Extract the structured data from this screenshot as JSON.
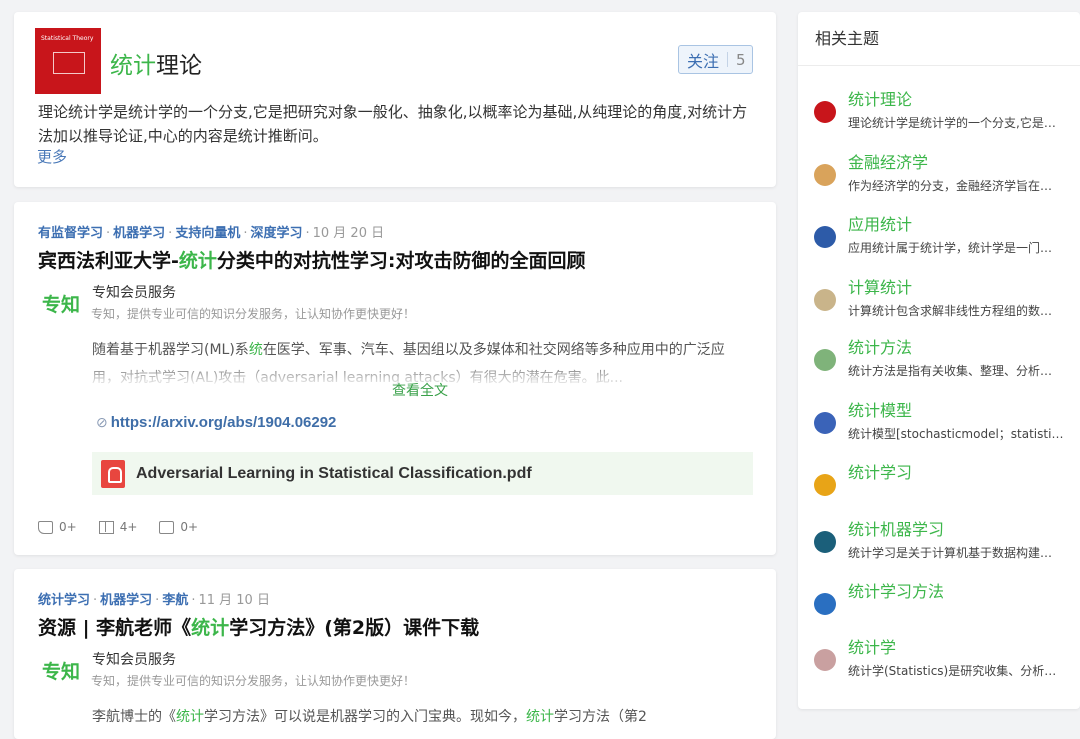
{
  "topic": {
    "cover_text": "Statistical Theory",
    "title_hl": "统计",
    "title_rest": "理论",
    "follow_label": "关注",
    "follow_count": "5",
    "description": "理论统计学是统计学的一个分支,它是把研究对象一般化、抽象化,以概率论为基础,从纯理论的角度,对统计方法加以推导论证,中心的内容是统计推断问。",
    "more": "更多"
  },
  "articles": [
    {
      "tags": [
        "有监督学习",
        "机器学习",
        "支持向量机",
        "深度学习"
      ],
      "date": "10 月 20 日",
      "title_pre": "宾西法利亚大学-",
      "title_hl": "统计",
      "title_post": "分类中的对抗性学习:对攻击防御的全面回顾",
      "logo": "专知",
      "author_name": "专知会员服务",
      "author_desc": "专知，提供专业可信的知识分发服务，让认知协作更快更好！",
      "excerpt_pre": "随着基于机器学习(ML)系",
      "excerpt_hl": "统",
      "excerpt_post": "在医学、军事、汽车、基因组以及多媒体和社交网络等多种应用中的广泛应用，对抗式学习(AL)攻击（adversarial learning attacks）有很大的潜在危害。此...",
      "read_more": "查看全文",
      "link": "https://arxiv.org/abs/1904.06292",
      "pdf": "Adversarial Learning in Statistical Classification.pdf",
      "likes": "0+",
      "reads": "4+",
      "comments": "0+"
    },
    {
      "tags": [
        "统计学习",
        "机器学习",
        "李航"
      ],
      "date": "11 月 10 日",
      "title_pre": "资源 | 李航老师《",
      "title_hl": "统计",
      "title_post": "学习方法》(第2版）课件下载",
      "logo": "专知",
      "author_name": "专知会员服务",
      "author_desc": "专知，提供专业可信的知识分发服务，让认知协作更快更好！",
      "excerpt_pre": "李航博士的《",
      "excerpt_hl": "统计",
      "excerpt_mid": "学习方法》可以说是机器学习的入门宝典。现如今，",
      "excerpt_hl2": "统计",
      "excerpt_post": "学习方法（第2"
    }
  ],
  "sidebar": {
    "title": "相关主题",
    "topics": [
      {
        "name_hl": "统计",
        "name_rest": "理论",
        "desc": "理论统计学是统计学的一个分支,它是把研究对象一般化、抽象化",
        "icon": "red-book-icon",
        "color": "#c8151b"
      },
      {
        "name_hl": "",
        "name_rest": "金融经济学",
        "desc": "作为经济学的分支，金融经济学旨在研究金融市场",
        "icon": "finance-icon",
        "color": "#d9a35b"
      },
      {
        "name_hl": "",
        "name_rest": "应用",
        "name_tail_hl": "统计",
        "desc": "应用统计属于统计学，统计学是一门收集、整理和分析",
        "icon": "applied-stats-icon",
        "color": "#2d5ba8"
      },
      {
        "name_hl": "",
        "name_rest": "计算",
        "name_tail_hl": "统计",
        "desc": "计算统计包含求解非线性方程组的数值方法",
        "icon": "computing-icon",
        "color": "#c9b48a"
      },
      {
        "name_hl": "统计",
        "name_rest": "方法",
        "desc": "统计方法是指有关收集、整理、分析和解释统计数据",
        "icon": "dots-icon",
        "color": "#7fb37a"
      },
      {
        "name_hl": "统计",
        "name_rest": "模型",
        "desc": "统计模型[stochasticmodel；statistical model]",
        "icon": "model-icon",
        "color": "#3a63b8"
      },
      {
        "name_hl": "统计",
        "name_rest": "学习",
        "desc": "",
        "icon": "learning-icon",
        "color": "#e8a417"
      },
      {
        "name_hl": "统计",
        "name_rest": "机器学习",
        "desc": "统计学习是关于计算机基于数据构建概率统计模型",
        "icon": "ml-icon",
        "color": "#1b5f7a"
      },
      {
        "name_hl": "统计",
        "name_rest": "学习方法",
        "desc": "",
        "icon": "book-icon",
        "color": "#2a6fc1"
      },
      {
        "name_hl": "统计",
        "name_rest": "学",
        "desc": "统计学(Statistics)是研究收集、分析、解释和呈现数据的科学",
        "icon": "stats-icon",
        "color": "#c9a0a0"
      }
    ]
  }
}
